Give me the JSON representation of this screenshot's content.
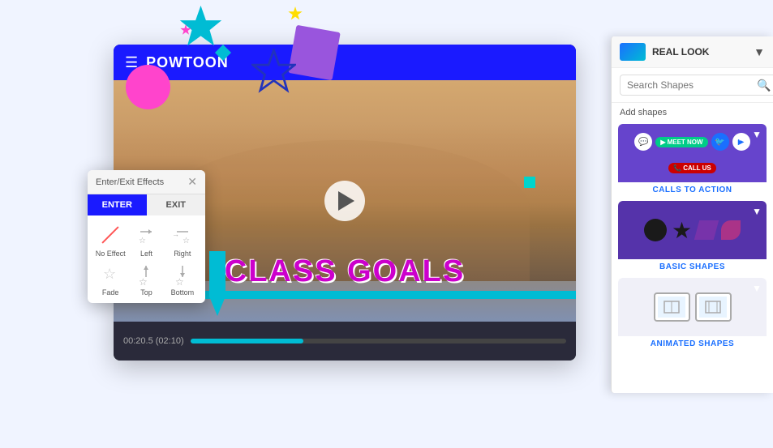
{
  "app": {
    "name": "Powtoon"
  },
  "topbar": {
    "logo": "POWTOON",
    "real_look_label": "REAL LOOK"
  },
  "shapes_panel": {
    "search_placeholder": "Search Shapes",
    "add_shapes_label": "Add shapes",
    "dropdown_label": "REAL LOOK",
    "categories": [
      {
        "id": "calls-to-action",
        "name": "CALLS TO ACTION",
        "type": "cta"
      },
      {
        "id": "basic-shapes",
        "name": "BASIC SHAPES",
        "type": "basic"
      },
      {
        "id": "animated-shapes",
        "name": "ANIMATED SHAPES",
        "type": "animated"
      }
    ]
  },
  "effects_panel": {
    "title": "Enter/Exit Effects",
    "tabs": [
      {
        "label": "ENTER",
        "active": true
      },
      {
        "label": "EXIT",
        "active": false
      }
    ],
    "effects": [
      {
        "label": "No Effect",
        "icon": "none"
      },
      {
        "label": "Left",
        "icon": "left"
      },
      {
        "label": "Right",
        "icon": "right"
      },
      {
        "label": "Fade",
        "icon": "fade"
      },
      {
        "label": "Top",
        "icon": "top"
      },
      {
        "label": "Bottom",
        "icon": "bottom"
      }
    ]
  },
  "video": {
    "text_overlay": "CLASS GOALS",
    "timestamp": "00:20.5 (02:10)"
  },
  "icons": {
    "hamburger": "☰",
    "play": "▶",
    "search": "🔍",
    "dropdown": "▼",
    "close": "✕"
  }
}
